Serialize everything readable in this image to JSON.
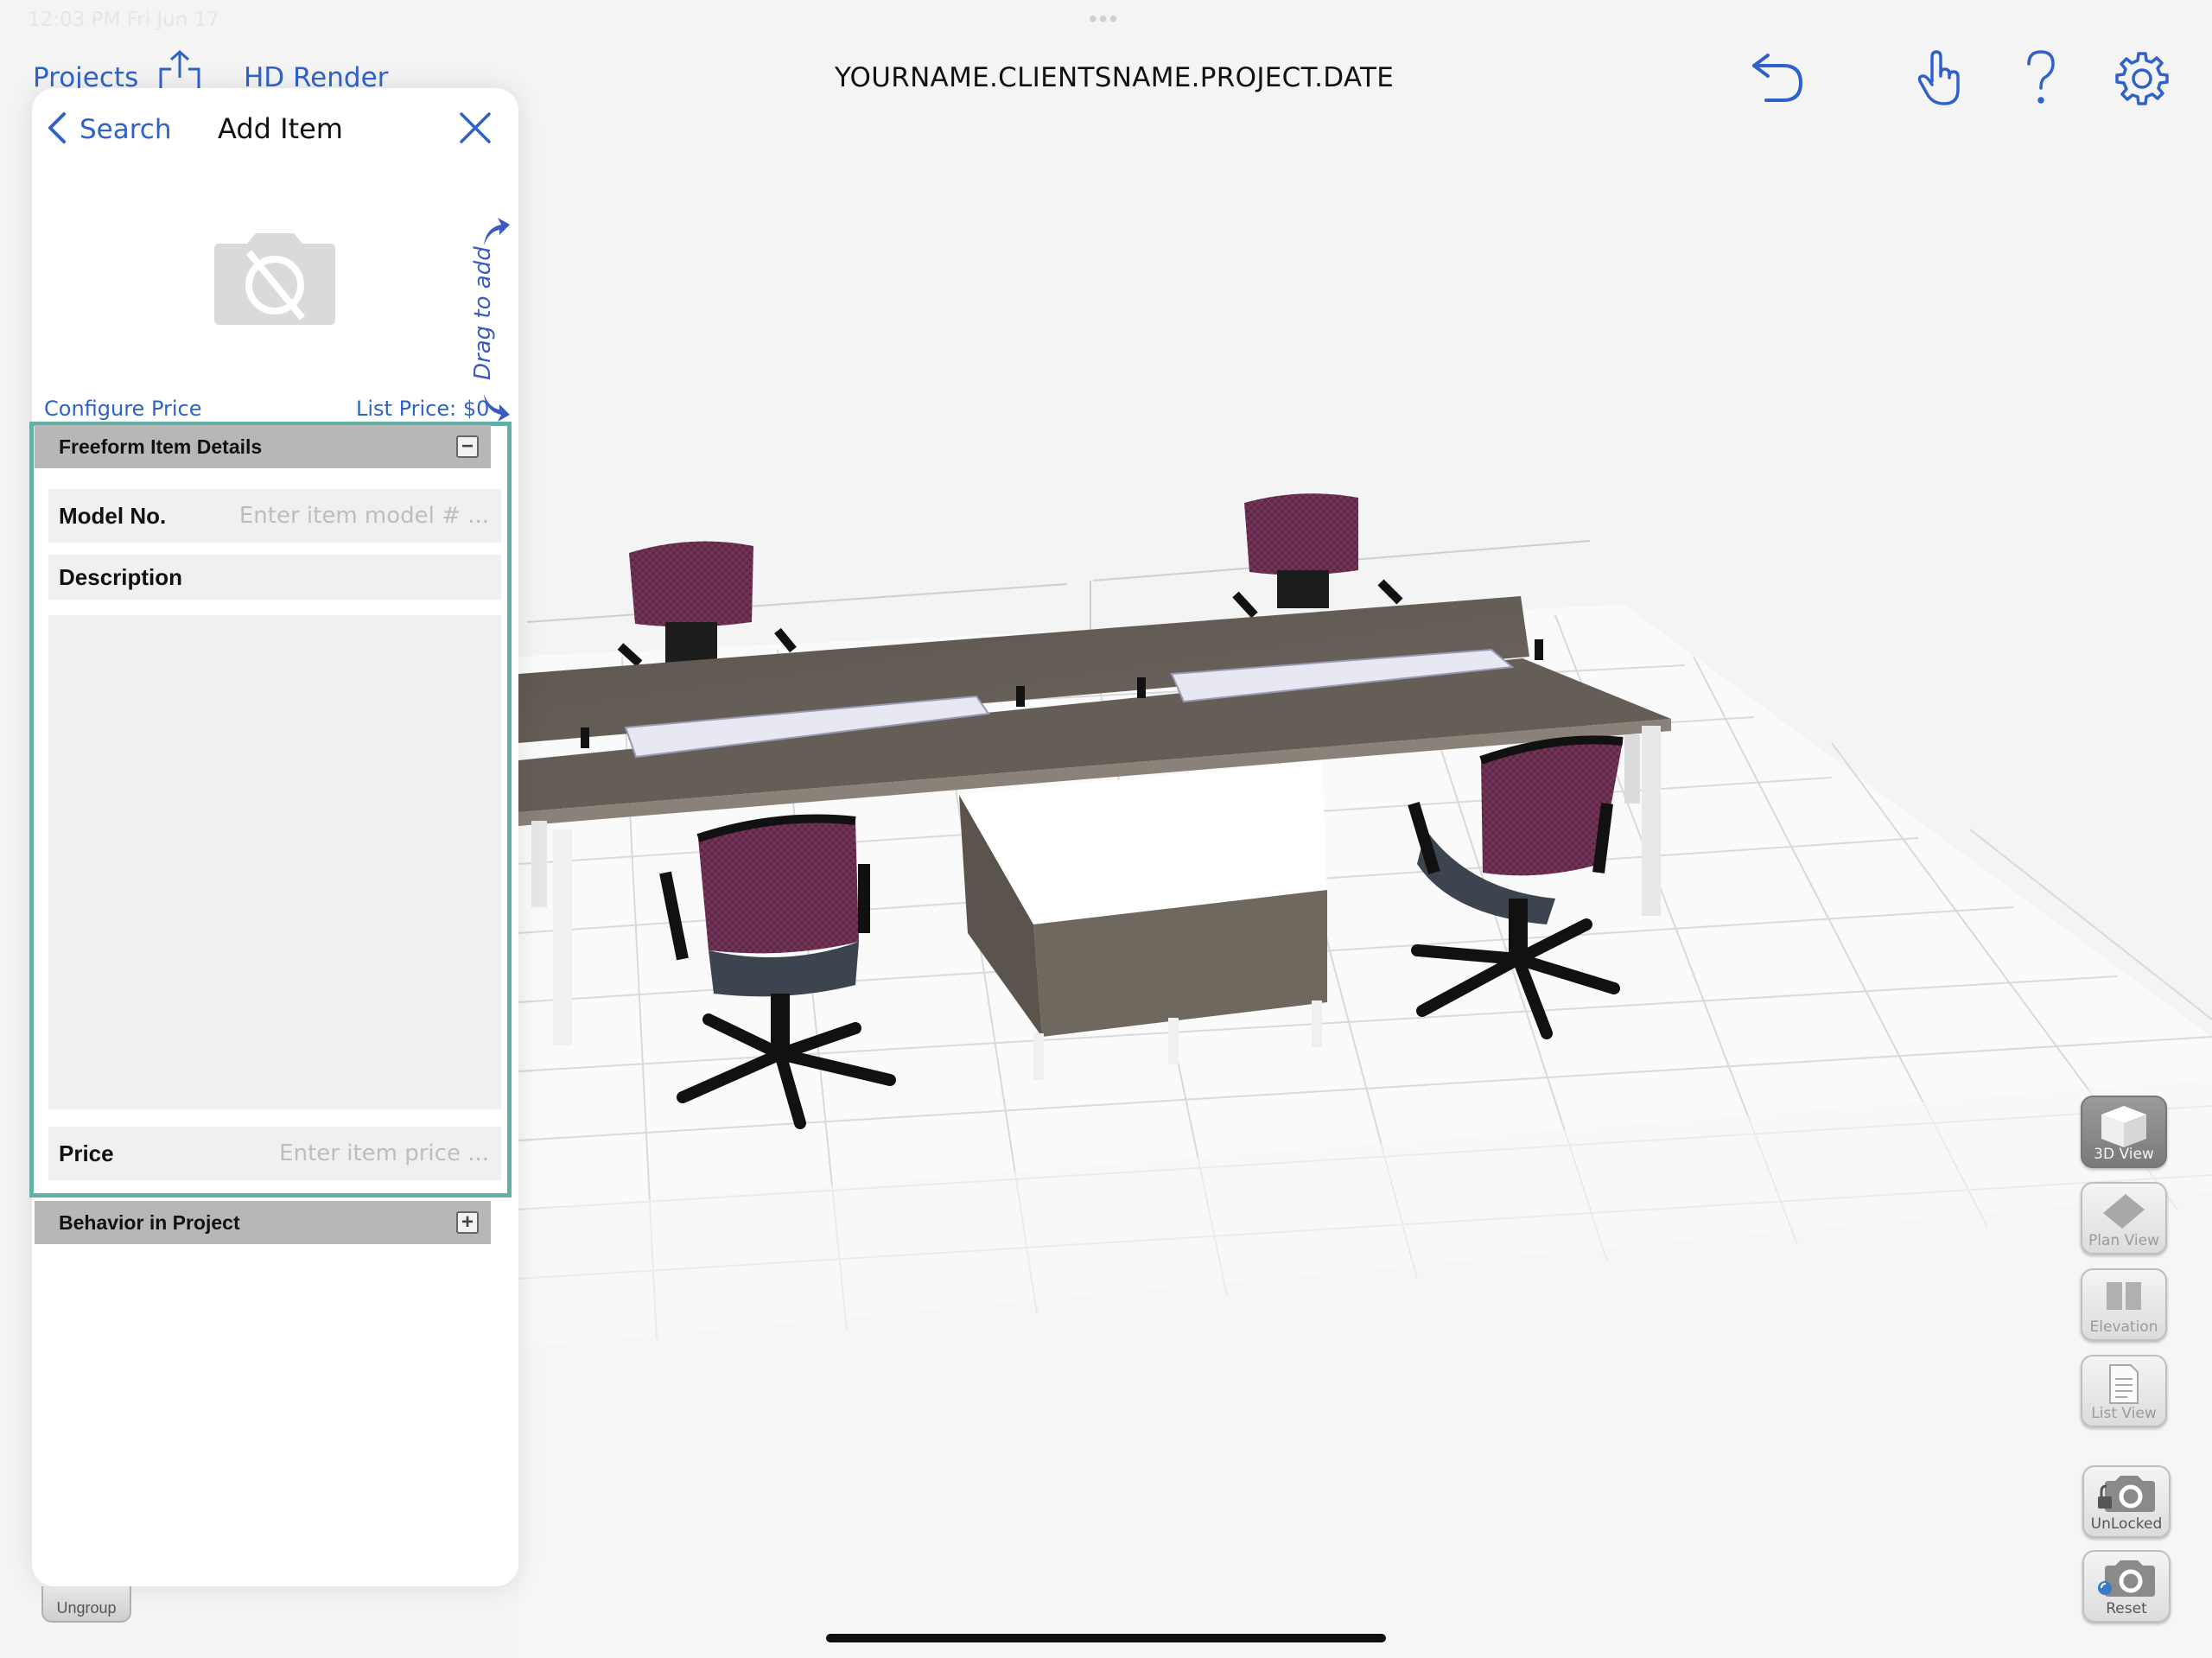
{
  "status_bar": {
    "time_date": "12:03 PM   Fri Jun 17",
    "dots": "•••"
  },
  "topbar": {
    "projects_label": "Projects",
    "hd_render_label": "HD Render",
    "title": "YOURNAME.CLIENTSNAME.PROJECT.DATE",
    "icons": [
      "share-icon",
      "undo-icon",
      "hand-pointer-icon",
      "help-icon",
      "settings-gear-icon"
    ]
  },
  "panel": {
    "back_label": "Search",
    "title": "Add Item",
    "drag_hint": "Drag to add",
    "configure_price_label": "Configure Price",
    "list_price_label": "List Price: $0",
    "freeform_section": {
      "header": "Freeform Item Details",
      "toggle": "−",
      "model_label": "Model No.",
      "model_placeholder": "Enter item model # ...",
      "description_label": "Description",
      "description_value": "",
      "price_label": "Price",
      "price_placeholder": "Enter item price ..."
    },
    "behavior_section": {
      "header": "Behavior in Project",
      "toggle": "+"
    }
  },
  "view_buttons": [
    {
      "label": "3D View",
      "active": true
    },
    {
      "label": "Plan View",
      "active": false
    },
    {
      "label": "Elevation",
      "active": false
    },
    {
      "label": "List View",
      "active": false
    }
  ],
  "camera_buttons": {
    "lock_label": "UnLocked",
    "reset_label": "Reset"
  },
  "ungroup_label": "Ungroup",
  "colors": {
    "accent_blue": "#2f62c9",
    "section_outline": "#63b1a6",
    "section_header": "#b7b7b7",
    "chair_mesh": "#5e2747",
    "desk_top": "#645d56"
  }
}
